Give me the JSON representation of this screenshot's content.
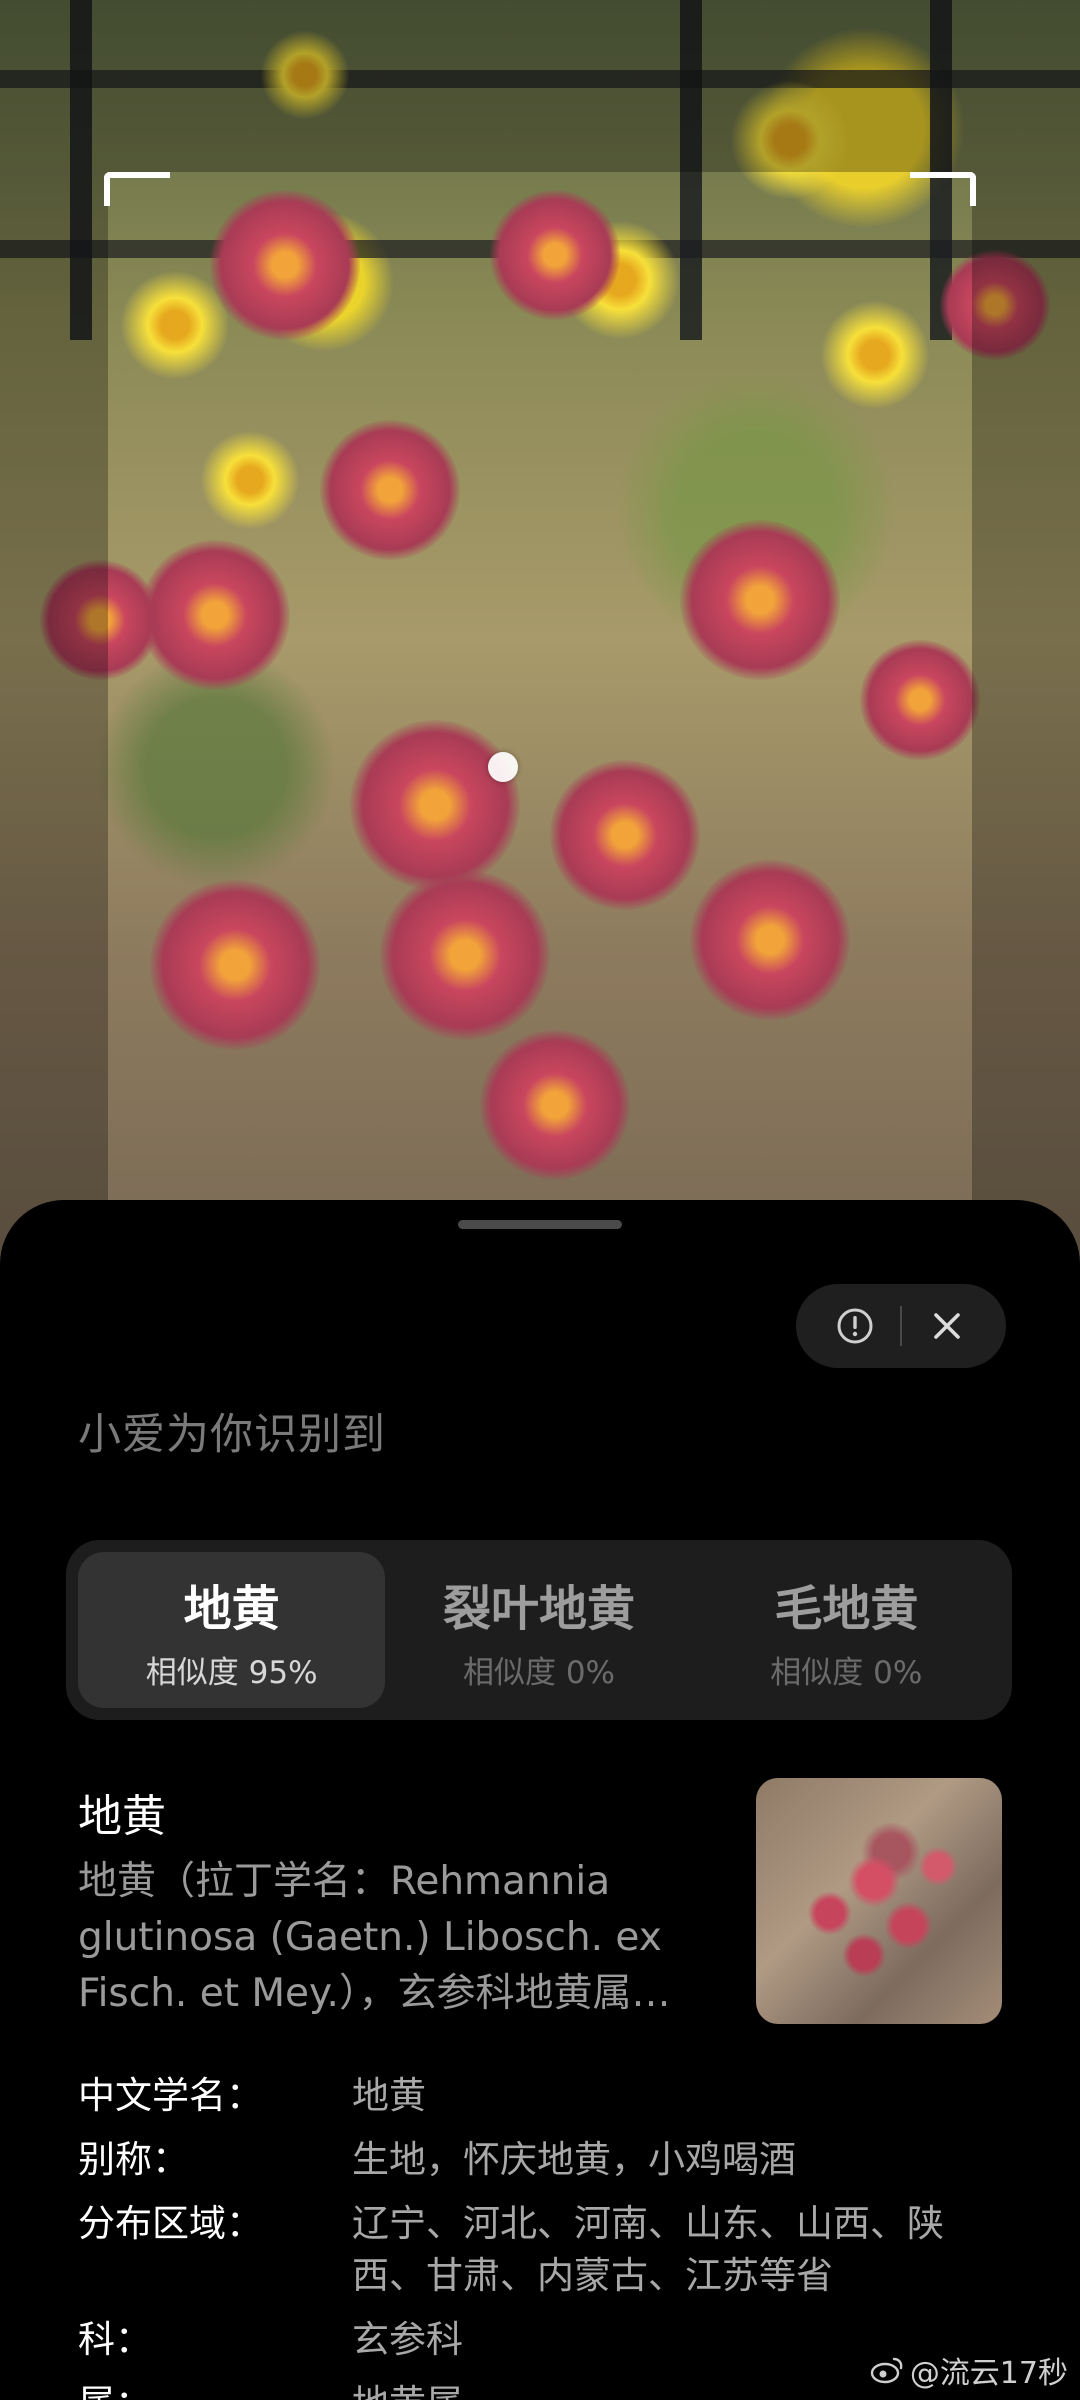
{
  "panel": {
    "heading": "小爱为你识别到",
    "tabs": [
      {
        "name": "地黄",
        "similarity": "相似度 95%",
        "active": true
      },
      {
        "name": "裂叶地黄",
        "similarity": "相似度 0%",
        "active": false
      },
      {
        "name": "毛地黄",
        "similarity": "相似度 0%",
        "active": false
      }
    ],
    "result": {
      "title": "地黄",
      "description": "地黄（拉丁学名：Rehmannia glutinosa (Gaetn.) Libosch. ex Fisch. et Mey.），玄参科地黄属多年生草本植物"
    },
    "details": [
      {
        "label": "中文学名：",
        "value": "地黄"
      },
      {
        "label": "别称：",
        "value": "生地，怀庆地黄，小鸡喝酒"
      },
      {
        "label": "分布区域：",
        "value": "辽宁、河北、河南、山东、山西、陕西、甘肃、内蒙古、江苏等省"
      },
      {
        "label": "科：",
        "value": "玄参科"
      },
      {
        "label": "属：",
        "value": "地黄属"
      }
    ],
    "buttons": {
      "feedback_icon": "exclamation-circle-icon",
      "close_icon": "close-icon"
    }
  },
  "watermark": "@流云17秒",
  "colors": {
    "sheet_bg": "#000000",
    "tab_bar_bg": "#1d1d1d",
    "tab_active_bg": "#333333"
  }
}
